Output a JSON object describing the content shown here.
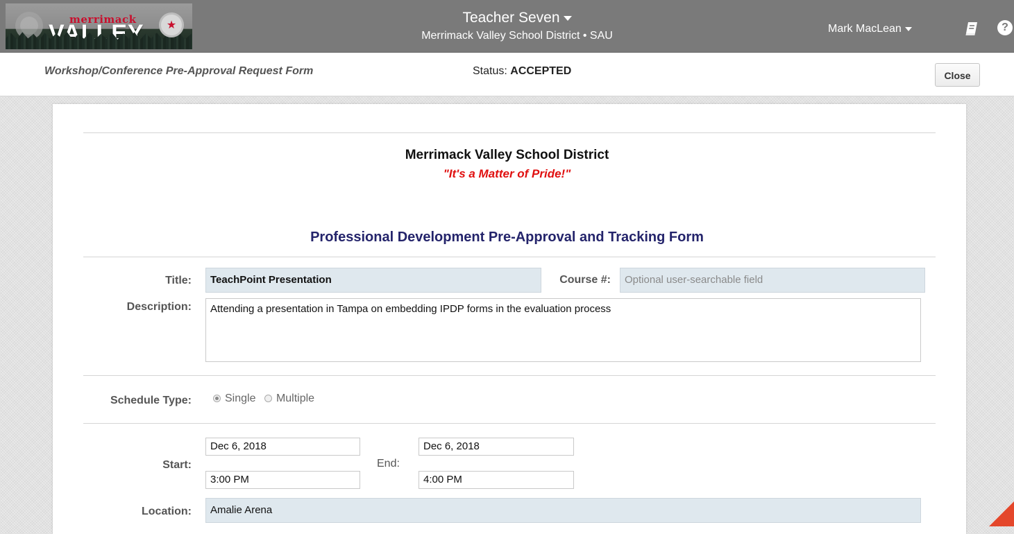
{
  "header": {
    "logo": {
      "brand_top": "merrimack",
      "brand_main": "VALLEY"
    },
    "teacher_name": "Teacher Seven",
    "district_line": "Merrimack Valley School District • SAU",
    "user_name": "Mark MacLean",
    "icons": [
      "book-icon",
      "help-icon"
    ],
    "help_glyph": "?"
  },
  "subheader": {
    "form_name": "Workshop/Conference Pre-Approval Request Form",
    "status_label": "Status:",
    "status_value": "ACCEPTED",
    "close_label": "Close"
  },
  "form": {
    "district": "Merrimack Valley School District",
    "motto": "\"It's a Matter of Pride!\"",
    "title": "Professional Development Pre-Approval and Tracking Form",
    "title_label": "Title:",
    "title_value": "TeachPoint Presentation",
    "course_label": "Course #:",
    "course_placeholder": "Optional user-searchable field",
    "description_label": "Description:",
    "description_value": "Attending a presentation in Tampa on embedding IPDP forms in the evaluation process",
    "schedule_label": "Schedule Type:",
    "schedule_options": [
      {
        "label": "Single",
        "checked": true
      },
      {
        "label": "Multiple",
        "checked": false
      }
    ],
    "start_label": "Start:",
    "start_date": "Dec 6, 2018",
    "start_time": "3:00 PM",
    "end_label": "End:",
    "end_date": "Dec 6, 2018",
    "end_time": "4:00 PM",
    "location_label": "Location:",
    "location_value": "Amalie Arena"
  },
  "colors": {
    "topbar": "#7a7a7a",
    "motto": "#e01010",
    "form_title": "#24246b",
    "field_bg": "#dfe8ee"
  }
}
